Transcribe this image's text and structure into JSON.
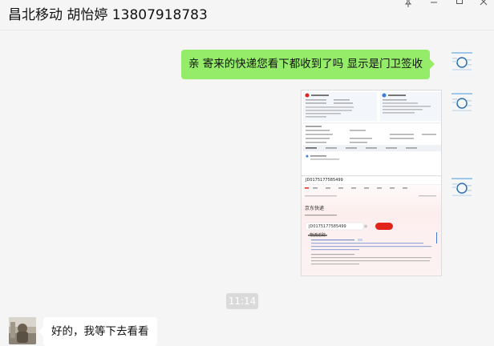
{
  "window": {
    "title": "昌北移动 胡怡婷 13807918783",
    "controls": [
      "pin-icon",
      "minimize-icon",
      "maximize-icon",
      "close-icon"
    ]
  },
  "messages": [
    {
      "direction": "outgoing",
      "type": "text",
      "text": "亲 寄来的快递您看下都收到了吗 显示是门卫签收"
    },
    {
      "direction": "outgoing",
      "type": "image",
      "description_id": "screenshot-1"
    },
    {
      "direction": "outgoing",
      "type": "image",
      "description_id": "screenshot-2"
    },
    {
      "direction": "incoming",
      "type": "text",
      "text": "好的，我等下去看看"
    }
  ],
  "timestamp": "11:14",
  "screenshot_2": {
    "tracking_number": "JD0175177585499",
    "heading": "京东快递",
    "query_value": "JD0175177585499",
    "section_title": "物流追踪"
  },
  "colors": {
    "background": "#f5f5f5",
    "outgoing_bubble": "#95ec69",
    "incoming_bubble": "#ffffff",
    "timestamp_badge": "#dadada",
    "accent_red": "#e2231a"
  }
}
